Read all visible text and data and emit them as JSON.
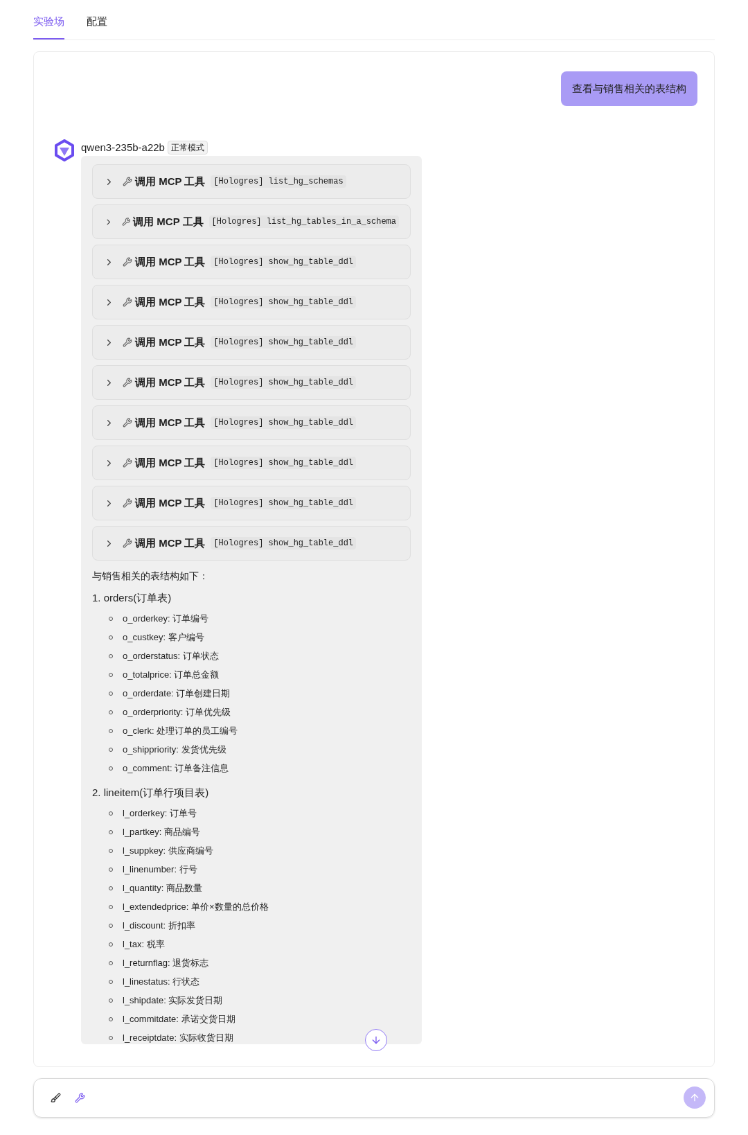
{
  "tabs": [
    {
      "label": "实验场",
      "selected": true
    },
    {
      "label": "配置",
      "selected": false
    }
  ],
  "user_message": "查看与销售相关的表结构",
  "assistant": {
    "model": "qwen3-235b-a22b",
    "mode_badge": "正常模式",
    "tool_calls": [
      {
        "label": "调用 MCP 工具",
        "tool": "[Hologres] list_hg_schemas",
        "expanded": false
      },
      {
        "label": "调用 MCP 工具",
        "tool": "[Hologres] list_hg_tables_in_a_schema",
        "expanded": false
      },
      {
        "label": "调用 MCP 工具",
        "tool": "[Hologres] show_hg_table_ddl",
        "expanded": false
      },
      {
        "label": "调用 MCP 工具",
        "tool": "[Hologres] show_hg_table_ddl",
        "expanded": false
      },
      {
        "label": "调用 MCP 工具",
        "tool": "[Hologres] show_hg_table_ddl",
        "expanded": false
      },
      {
        "label": "调用 MCP 工具",
        "tool": "[Hologres] show_hg_table_ddl",
        "expanded": false
      },
      {
        "label": "调用 MCP 工具",
        "tool": "[Hologres] show_hg_table_ddl",
        "expanded": false
      },
      {
        "label": "调用 MCP 工具",
        "tool": "[Hologres] show_hg_table_ddl",
        "expanded": false
      },
      {
        "label": "调用 MCP 工具",
        "tool": "[Hologres] show_hg_table_ddl",
        "expanded": false
      },
      {
        "label": "调用 MCP 工具",
        "tool": "[Hologres] show_hg_table_ddl",
        "expanded": false
      }
    ],
    "intro": "与销售相关的表结构如下：",
    "tables": [
      {
        "heading": "1. orders(订单表)",
        "fields": [
          "o_orderkey: 订单编号",
          "o_custkey: 客户编号",
          "o_orderstatus: 订单状态",
          "o_totalprice: 订单总金额",
          "o_orderdate: 订单创建日期",
          "o_orderpriority: 订单优先级",
          "o_clerk: 处理订单的员工编号",
          "o_shippriority: 发货优先级",
          "o_comment: 订单备注信息"
        ]
      },
      {
        "heading": "2. lineitem(订单行项目表)",
        "fields": [
          "l_orderkey: 订单号",
          "l_partkey: 商品编号",
          "l_suppkey: 供应商编号",
          "l_linenumber: 行号",
          "l_quantity: 商品数量",
          "l_extendedprice: 单价×数量的总价格",
          "l_discount: 折扣率",
          "l_tax: 税率",
          "l_returnflag: 退货标志",
          "l_linestatus: 行状态",
          "l_shipdate: 实际发货日期",
          "l_commitdate: 承诺交货日期",
          "l_receiptdate: 实际收货日期"
        ]
      }
    ]
  }
}
